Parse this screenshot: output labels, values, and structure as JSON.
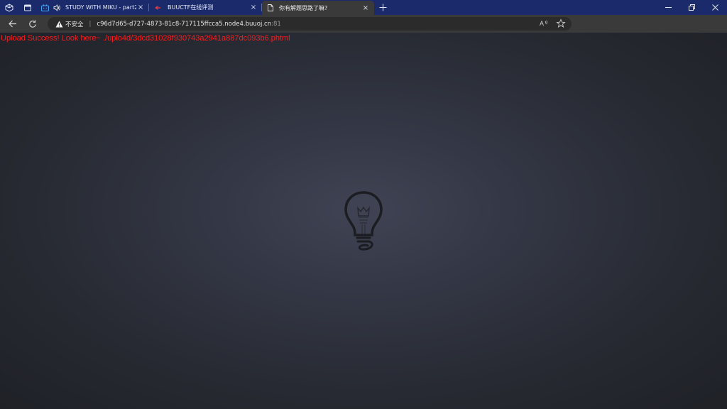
{
  "tabs": [
    {
      "title": "STUDY WITH MIKU - part2",
      "close": "×",
      "icon": "bilibili-tv-icon",
      "audio": true
    },
    {
      "title": "BUUCTF在线评测",
      "close": "×",
      "icon": "buuctf-favicon"
    },
    {
      "title": "你有解题思路了嘛?",
      "close": "×",
      "icon": "document-icon",
      "active": true
    }
  ],
  "toolbar": {
    "security_label": "不安全",
    "url_host": "c96d7d65-d727-4873-81c8-717115ffcca5.node4.buuoj.cn",
    "url_port": ":81"
  },
  "page": {
    "upload_message": "Upload Success! Look here~ ./uplo4d/3dcd31028f930743a2941a887dc093b6.phtml",
    "message_color": "#ff1a1a"
  },
  "colors": {
    "tabbar": "#1b2a6b",
    "toolbar": "#3a3a3a",
    "background": "#2a2d36"
  }
}
